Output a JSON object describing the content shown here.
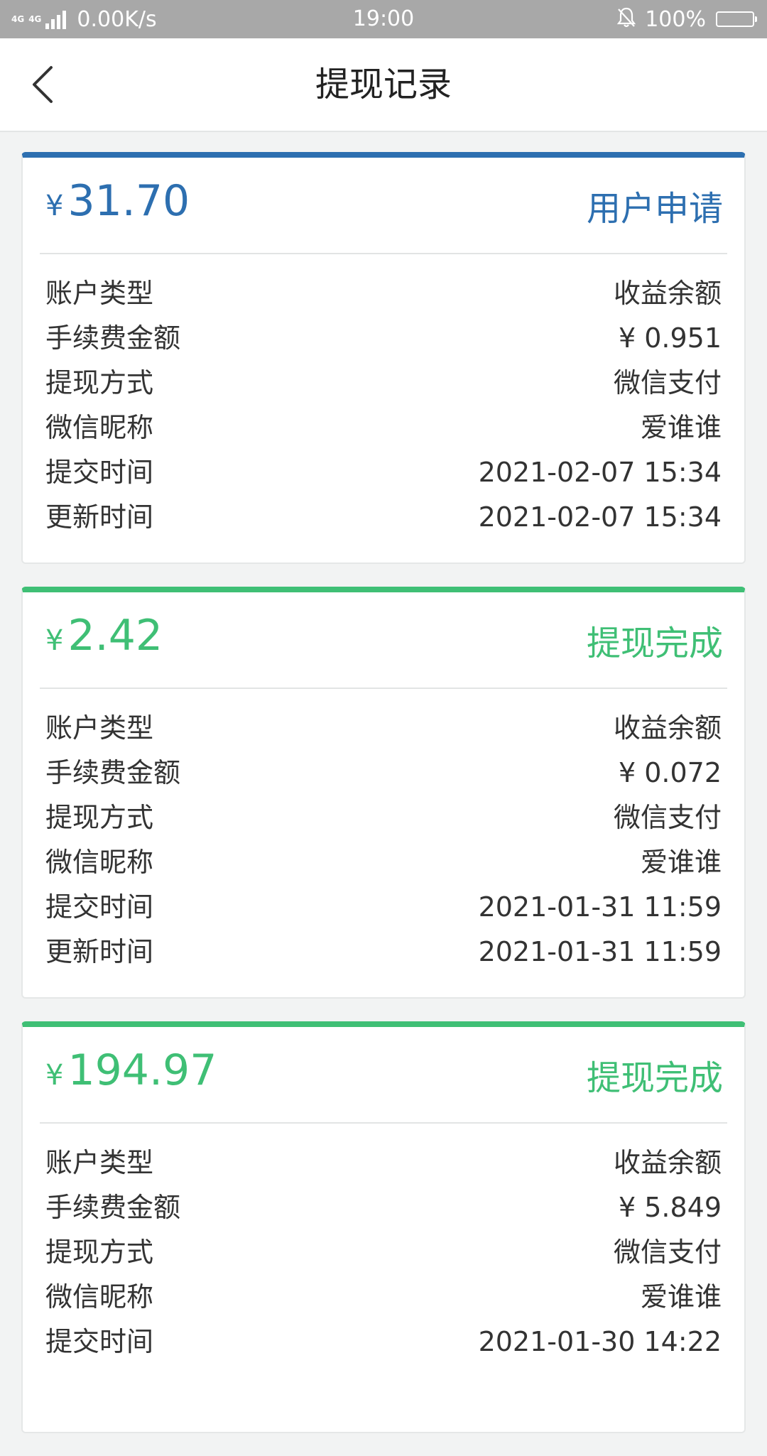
{
  "status_bar": {
    "network": "4G",
    "network2": "4G",
    "speed": "0.00K/s",
    "time": "19:00",
    "battery": "100%"
  },
  "header": {
    "title": "提现记录"
  },
  "labels": {
    "account_type": "账户类型",
    "fee": "手续费金额",
    "method": "提现方式",
    "nickname": "微信昵称",
    "submit_time": "提交时间",
    "update_time": "更新时间"
  },
  "currency": "¥",
  "records": [
    {
      "amount": "31.70",
      "status": "用户申请",
      "status_color": "#2d6fb0",
      "account_type": "收益余额",
      "fee": "¥ 0.951",
      "method": "微信支付",
      "nickname": "爱谁谁",
      "submit_time": "2021-02-07 15:34",
      "update_time": "2021-02-07 15:34"
    },
    {
      "amount": "2.42",
      "status": "提现完成",
      "status_color": "#3fbf75",
      "account_type": "收益余额",
      "fee": "¥ 0.072",
      "method": "微信支付",
      "nickname": "爱谁谁",
      "submit_time": "2021-01-31 11:59",
      "update_time": "2021-01-31 11:59"
    },
    {
      "amount": "194.97",
      "status": "提现完成",
      "status_color": "#3fbf75",
      "account_type": "收益余额",
      "fee": "¥ 5.849",
      "method": "微信支付",
      "nickname": "爱谁谁",
      "submit_time": "2021-01-30 14:22"
    }
  ]
}
